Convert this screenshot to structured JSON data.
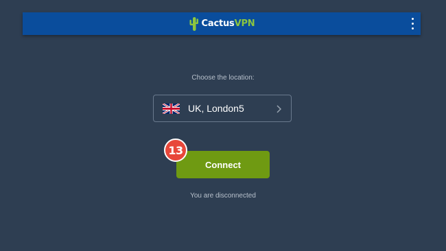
{
  "app_bar": {
    "logo_primary": "Cactus",
    "logo_accent": "VPN",
    "logo_icon": "cactus-icon",
    "menu_icon": "more-vert-icon",
    "background_color": "#0a4d9c"
  },
  "location": {
    "caption": "Choose the location:",
    "selected": "UK, London5",
    "flag_icon": "uk-flag-icon",
    "chevron_icon": "chevron-right-icon"
  },
  "connect_button": {
    "label": "Connect",
    "color": "#6f9a12"
  },
  "step_badge": {
    "number": "13",
    "color": "#e8473a"
  },
  "status": {
    "text": "You are disconnected"
  },
  "theme": {
    "background": "#2e3e52",
    "accent_green": "#8cc63f"
  }
}
